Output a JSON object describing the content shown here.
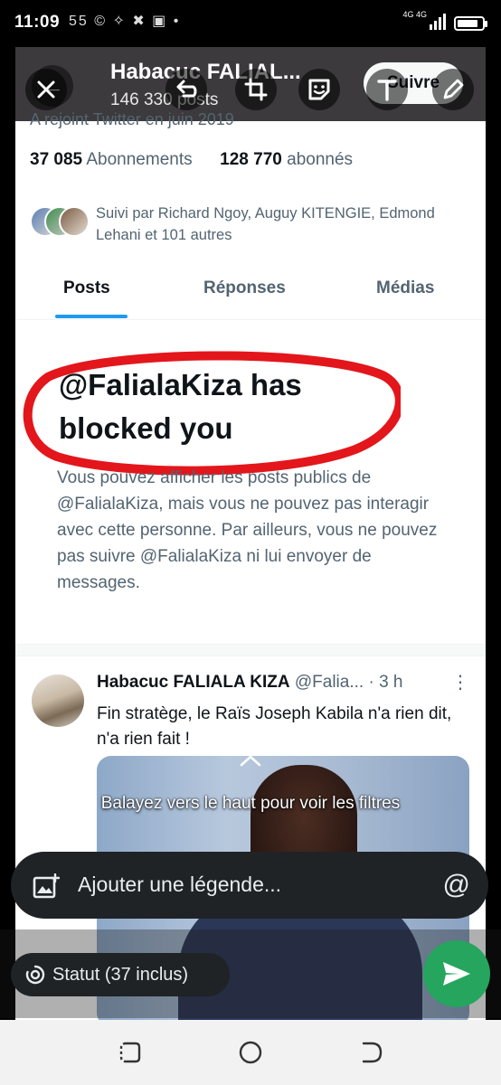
{
  "status_bar": {
    "time": "11:09",
    "notification_icons": "55 © ✧ ✖ ▣ •",
    "network": "4G 4G",
    "battery_level": 0.85
  },
  "twitter_header": {
    "display_name": "Habacuc FALIAL...",
    "post_count": "146 330 posts",
    "follow_label": "Suivre"
  },
  "profile": {
    "joined": "A rejoint Twitter en juin 2019",
    "following_count": "37 085",
    "following_label": "Abonnements",
    "followers_count": "128 770",
    "followers_label": "abonnés",
    "followed_by": "Suivi par Richard Ngoy, Auguy KITENGIE, Edmond Lehani et 101 autres"
  },
  "tabs": [
    {
      "label": "Posts",
      "active": true
    },
    {
      "label": "Réponses",
      "active": false
    },
    {
      "label": "Médias",
      "active": false
    }
  ],
  "blocked": {
    "title": "@FalialaKiza has blocked you",
    "body": "Vous pouvez afficher les posts publics de @FalialaKiza, mais vous ne pouvez pas interagir avec cette personne. Par ailleurs, vous ne pouvez pas suivre @FalialaKiza ni lui envoyer de messages."
  },
  "tweet": {
    "author": "Habacuc FALIALA KIZA",
    "handle": "@Falia...",
    "time": "· 3 h",
    "text": "Fin stratège, le Raïs Joseph Kabila n'a rien dit, n'a rien fait !"
  },
  "editor": {
    "swipe_hint": "Balayez vers le haut pour voir les filtres",
    "caption_placeholder": "Ajouter une légende...",
    "mention_symbol": "@",
    "status_label": "Statut (37 inclus)"
  },
  "colors": {
    "twitter_blue": "#1d9bf0",
    "annotation_red": "#e3161c",
    "send_green": "#25a55e",
    "editor_dark": "#1f2326"
  }
}
